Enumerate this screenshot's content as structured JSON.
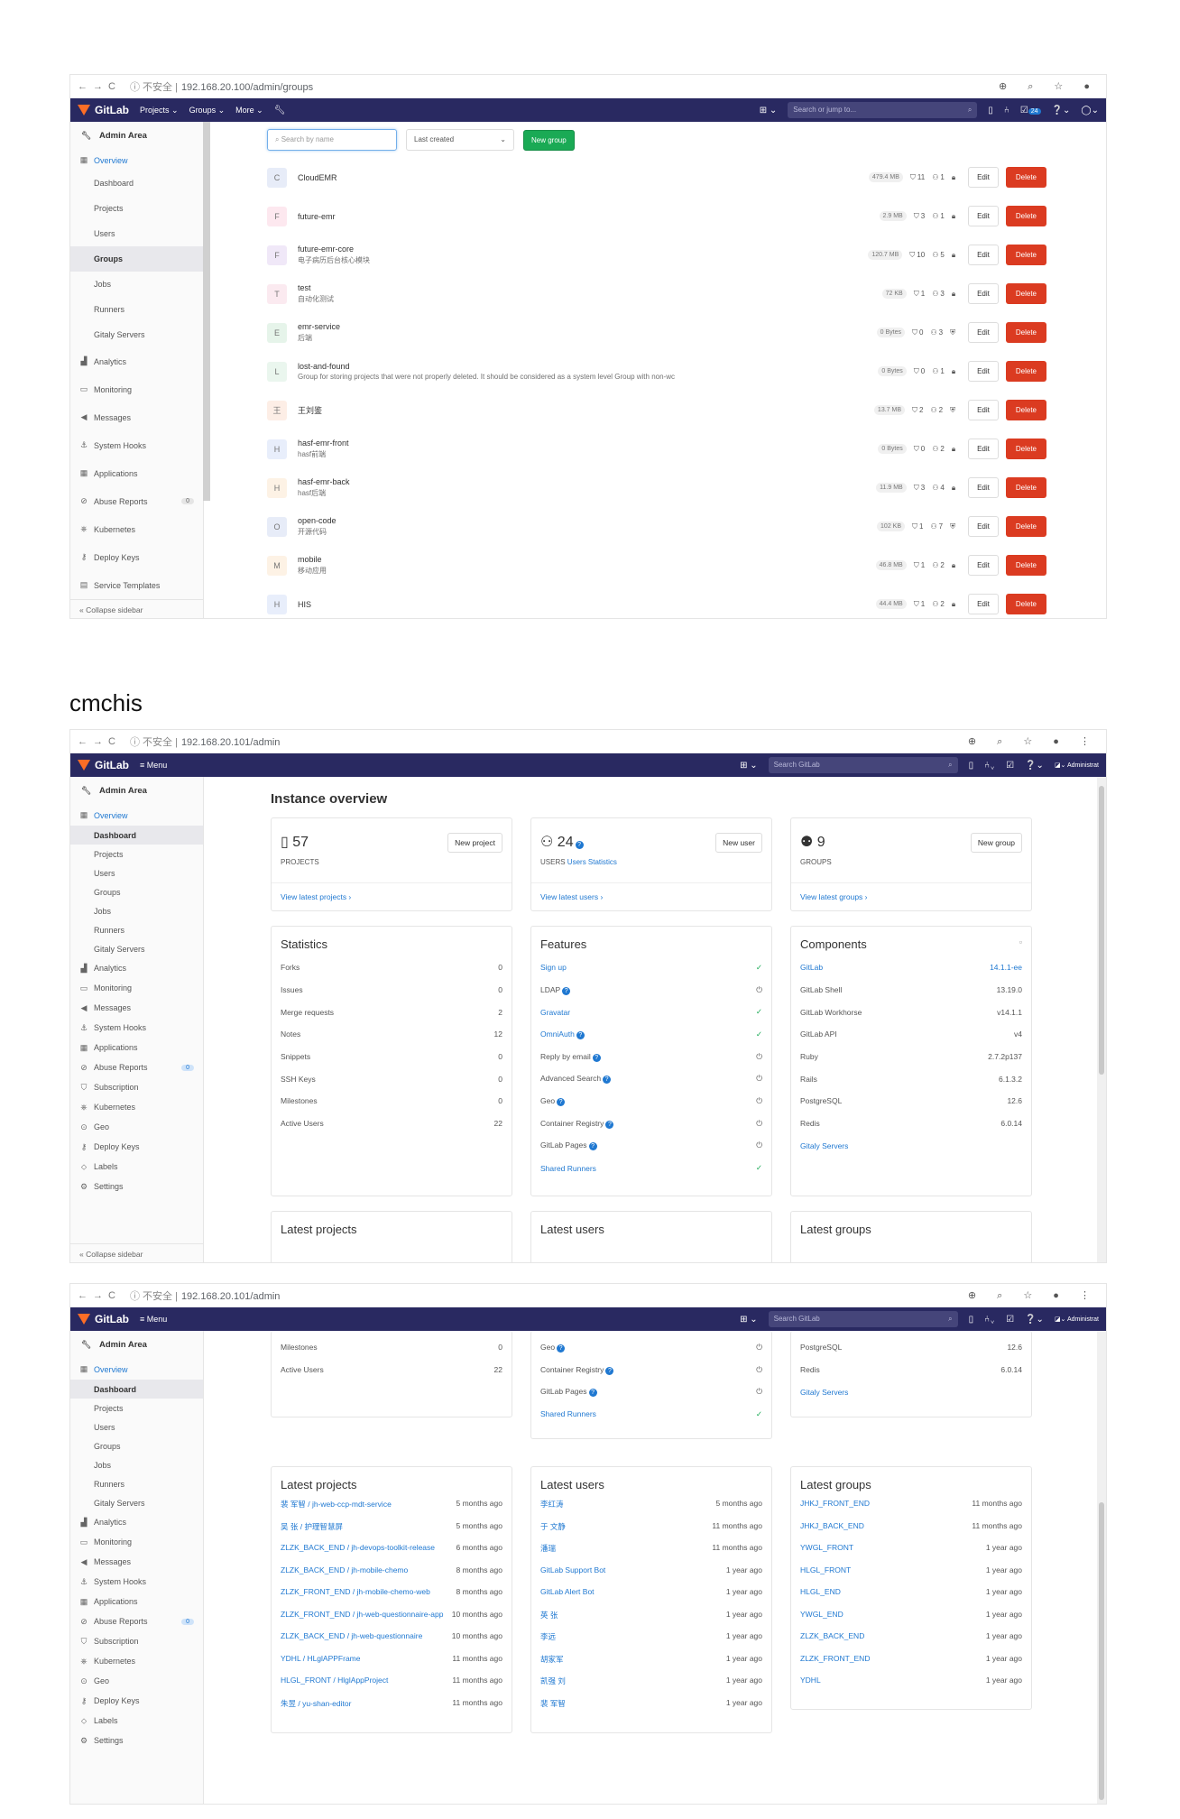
{
  "shot1": {
    "chrome": {
      "nav": "←→C",
      "insecure": "ⓘ 不安全 |",
      "url": "192.168.20.100/admin/groups",
      "right_icons": "⊕ ⌕ ☆ ●"
    },
    "gitlab": {
      "brand": "GitLab",
      "nav": [
        "Projects ⌄",
        "Groups ⌄",
        "More ⌄"
      ],
      "search_placeholder": "Search or jump to...",
      "todo_count": "24"
    },
    "sidebar": {
      "header": "Admin Area",
      "overview": "Overview",
      "subs": [
        "Dashboard",
        "Projects",
        "Users",
        "Groups",
        "Jobs",
        "Runners",
        "Gitaly Servers"
      ],
      "items": [
        "Analytics",
        "Monitoring",
        "Messages",
        "System Hooks",
        "Applications",
        "Abuse Reports",
        "Kubernetes",
        "Deploy Keys",
        "Service Templates"
      ],
      "abuse_count": "0",
      "collapse": "Collapse sidebar"
    },
    "filters": {
      "search_placeholder": "Search by name",
      "sort": "Last created",
      "new_group": "New group"
    },
    "groups": [
      {
        "letter": "C",
        "name": "CloudEMR",
        "desc": "",
        "size": "479.4 MB",
        "projects": "11",
        "members": "1",
        "vis": "lock"
      },
      {
        "letter": "F",
        "name": "future-emr",
        "desc": "",
        "size": "2.9 MB",
        "projects": "3",
        "members": "1",
        "vis": "lock"
      },
      {
        "letter": "F",
        "name": "future-emr-core",
        "desc": "电子病历后台核心模块",
        "size": "120.7 MB",
        "projects": "10",
        "members": "5",
        "vis": "lock"
      },
      {
        "letter": "T",
        "name": "test",
        "desc": "自动化测试",
        "size": "72 KB",
        "projects": "1",
        "members": "3",
        "vis": "lock"
      },
      {
        "letter": "E",
        "name": "emr-service",
        "desc": "后端",
        "size": "0 Bytes",
        "projects": "0",
        "members": "3",
        "vis": "shield"
      },
      {
        "letter": "L",
        "name": "lost-and-found",
        "desc": "Group for storing projects that were not properly deleted. It should be considered as a system level Group with non-wc",
        "size": "0 Bytes",
        "projects": "0",
        "members": "1",
        "vis": "lock"
      },
      {
        "letter": "王",
        "name": "王刘鉴",
        "desc": "",
        "size": "13.7 MB",
        "projects": "2",
        "members": "2",
        "vis": "shield"
      },
      {
        "letter": "H",
        "name": "hasf-emr-front",
        "desc": "hasf前端",
        "size": "0 Bytes",
        "projects": "0",
        "members": "2",
        "vis": "lock"
      },
      {
        "letter": "H",
        "name": "hasf-emr-back",
        "desc": "hasf后端",
        "size": "11.9 MB",
        "projects": "3",
        "members": "4",
        "vis": "lock"
      },
      {
        "letter": "O",
        "name": "open-code",
        "desc": "开源代码",
        "size": "102 KB",
        "projects": "1",
        "members": "7",
        "vis": "shield"
      },
      {
        "letter": "M",
        "name": "mobile",
        "desc": "移动应用",
        "size": "46.8 MB",
        "projects": "1",
        "members": "2",
        "vis": "lock"
      },
      {
        "letter": "H",
        "name": "HIS",
        "desc": "",
        "size": "44.4 MB",
        "projects": "1",
        "members": "2",
        "vis": "lock"
      }
    ],
    "edit_label": "Edit",
    "delete_label": "Delete"
  },
  "caption": "cmchis",
  "shot2": {
    "chrome": {
      "nav": "←→C",
      "insecure": "ⓘ 不安全 |",
      "url": "192.168.20.101/admin",
      "right_icons": "⊕ ⌕ ☆ ● ⋮"
    },
    "gitlab": {
      "brand": "GitLab",
      "menu": "≡ Menu",
      "search_placeholder": "Search GitLab",
      "user_label": "Administrat"
    },
    "sidebar": {
      "header": "Admin Area",
      "overview": "Overview",
      "subs": [
        "Dashboard",
        "Projects",
        "Users",
        "Groups",
        "Jobs",
        "Runners",
        "Gitaly Servers"
      ],
      "items": [
        "Analytics",
        "Monitoring",
        "Messages",
        "System Hooks",
        "Applications",
        "Abuse Reports",
        "Subscription",
        "Kubernetes",
        "Geo",
        "Deploy Keys",
        "Labels",
        "Settings"
      ],
      "abuse_count": "0",
      "collapse": "Collapse sidebar"
    },
    "title": "Instance overview",
    "cards": [
      {
        "icon": "▯",
        "count": "57",
        "label": "PROJECTS",
        "extra": "",
        "button": "New project",
        "link": "View latest projects ›"
      },
      {
        "icon": "⚇",
        "count": "24",
        "label": "USERS",
        "extra": "Users Statistics",
        "button": "New user",
        "link": "View latest users ›"
      },
      {
        "icon": "⚉",
        "count": "9",
        "label": "GROUPS",
        "extra": "",
        "button": "New group",
        "link": "View latest groups ›"
      }
    ],
    "statistics": {
      "title": "Statistics",
      "rows": [
        [
          "Forks",
          "0"
        ],
        [
          "Issues",
          "0"
        ],
        [
          "Merge requests",
          "2"
        ],
        [
          "Notes",
          "12"
        ],
        [
          "Snippets",
          "0"
        ],
        [
          "SSH Keys",
          "0"
        ],
        [
          "Milestones",
          "0"
        ],
        [
          "Active Users",
          "22"
        ]
      ]
    },
    "features": {
      "title": "Features",
      "rows": [
        {
          "name": "Sign up",
          "link": true,
          "help": false,
          "state": "on"
        },
        {
          "name": "LDAP",
          "link": false,
          "help": true,
          "state": "off"
        },
        {
          "name": "Gravatar",
          "link": true,
          "help": false,
          "state": "on"
        },
        {
          "name": "OmniAuth",
          "link": true,
          "help": true,
          "state": "on"
        },
        {
          "name": "Reply by email",
          "link": false,
          "help": true,
          "state": "off"
        },
        {
          "name": "Advanced Search",
          "link": false,
          "help": true,
          "state": "off"
        },
        {
          "name": "Geo",
          "link": false,
          "help": true,
          "state": "off"
        },
        {
          "name": "Container Registry",
          "link": false,
          "help": true,
          "state": "off"
        },
        {
          "name": "GitLab Pages",
          "link": false,
          "help": true,
          "state": "off"
        },
        {
          "name": "Shared Runners",
          "link": true,
          "help": false,
          "state": "on"
        }
      ]
    },
    "components": {
      "title": "Components",
      "rows": [
        {
          "name": "GitLab",
          "value": "14.1.1-ee",
          "link": true
        },
        {
          "name": "GitLab Shell",
          "value": "13.19.0",
          "link": false
        },
        {
          "name": "GitLab Workhorse",
          "value": "v14.1.1",
          "link": false
        },
        {
          "name": "GitLab API",
          "value": "v4",
          "link": false
        },
        {
          "name": "Ruby",
          "value": "2.7.2p137",
          "link": false
        },
        {
          "name": "Rails",
          "value": "6.1.3.2",
          "link": false
        },
        {
          "name": "PostgreSQL",
          "value": "12.6",
          "link": false
        },
        {
          "name": "Redis",
          "value": "6.0.14",
          "link": false
        },
        {
          "name": "Gitaly Servers",
          "value": "",
          "link": true
        }
      ]
    },
    "latest_titles": [
      "Latest projects",
      "Latest users",
      "Latest groups"
    ]
  },
  "shot3": {
    "chrome": {
      "nav": "←→C",
      "insecure": "ⓘ 不安全 |",
      "url": "192.168.20.101/admin",
      "right_icons": "⊕ ⌕ ☆ ● ⋮"
    },
    "stats_tail": [
      [
        "Milestones",
        "0"
      ],
      [
        "Active Users",
        "22"
      ]
    ],
    "features_tail": [
      {
        "name": "Geo",
        "link": false,
        "help": true,
        "state": "off"
      },
      {
        "name": "Container Registry",
        "link": false,
        "help": true,
        "state": "off"
      },
      {
        "name": "GitLab Pages",
        "link": false,
        "help": true,
        "state": "off"
      },
      {
        "name": "Shared Runners",
        "link": true,
        "help": false,
        "state": "on"
      }
    ],
    "components_tail": [
      {
        "name": "PostgreSQL",
        "value": "12.6",
        "link": false
      },
      {
        "name": "Redis",
        "value": "6.0.14",
        "link": false
      },
      {
        "name": "Gitaly Servers",
        "value": "",
        "link": true
      }
    ],
    "latest_projects": [
      [
        "裴 军智 / jh-web-ccp-mdt-service",
        "5 months ago"
      ],
      [
        "吴 张 / 护理智慧屏",
        "5 months ago"
      ],
      [
        "ZLZK_BACK_END / jh-devops-toolkit-release",
        "6 months ago"
      ],
      [
        "ZLZK_BACK_END / jh-mobile-chemo",
        "8 months ago"
      ],
      [
        "ZLZK_FRONT_END / jh-mobile-chemo-web",
        "8 months ago"
      ],
      [
        "ZLZK_FRONT_END / jh-web-questionnaire-app",
        "10 months ago"
      ],
      [
        "ZLZK_BACK_END / jh-web-questionnaire",
        "10 months ago"
      ],
      [
        "YDHL / HLglAPPFrame",
        "11 months ago"
      ],
      [
        "HLGL_FRONT / HlglAppProject",
        "11 months ago"
      ],
      [
        "朱昱 / yu-shan-editor",
        "11 months ago"
      ]
    ],
    "latest_users": [
      [
        "李红涛",
        "5 months ago"
      ],
      [
        "于 文静",
        "11 months ago"
      ],
      [
        "潘瑞",
        "11 months ago"
      ],
      [
        "GitLab Support Bot",
        "1 year ago"
      ],
      [
        "GitLab Alert Bot",
        "1 year ago"
      ],
      [
        "英 张",
        "1 year ago"
      ],
      [
        "李远",
        "1 year ago"
      ],
      [
        "胡家军",
        "1 year ago"
      ],
      [
        "凯强 刘",
        "1 year ago"
      ],
      [
        "裴 军智",
        "1 year ago"
      ]
    ],
    "latest_groups": [
      [
        "JHKJ_FRONT_END",
        "11 months ago"
      ],
      [
        "JHKJ_BACK_END",
        "11 months ago"
      ],
      [
        "YWGL_FRONT",
        "1 year ago"
      ],
      [
        "HLGL_FRONT",
        "1 year ago"
      ],
      [
        "HLGL_END",
        "1 year ago"
      ],
      [
        "YWGL_END",
        "1 year ago"
      ],
      [
        "ZLZK_BACK_END",
        "1 year ago"
      ],
      [
        "ZLZK_FRONT_END",
        "1 year ago"
      ],
      [
        "YDHL",
        "1 year ago"
      ]
    ]
  }
}
